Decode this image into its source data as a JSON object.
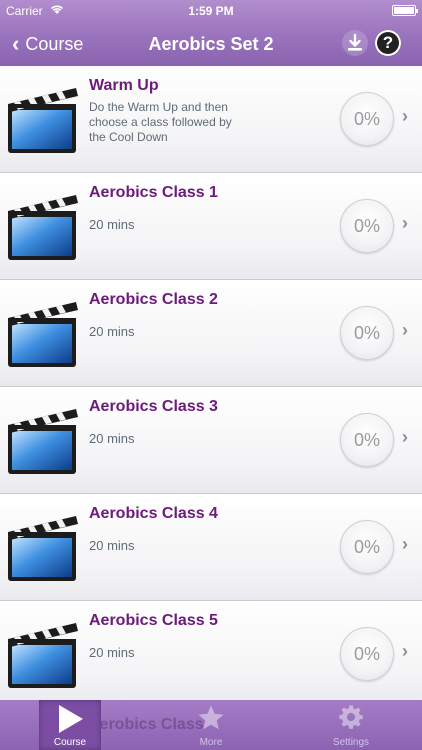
{
  "status_bar": {
    "carrier": "Carrier",
    "time": "1:59 PM"
  },
  "nav": {
    "back_label": "Course",
    "title": "Aerobics Set 2",
    "help_label": "?"
  },
  "lessons": [
    {
      "title": "Warm Up",
      "subtitle": "Do the Warm Up and then choose a class followed by the Cool Down",
      "progress": "0%"
    },
    {
      "title": "Aerobics Class 1",
      "subtitle": "20 mins",
      "progress": "0%"
    },
    {
      "title": "Aerobics Class 2",
      "subtitle": "20 mins",
      "progress": "0%"
    },
    {
      "title": "Aerobics Class 3",
      "subtitle": "20 mins",
      "progress": "0%"
    },
    {
      "title": "Aerobics Class 4",
      "subtitle": "20 mins",
      "progress": "0%"
    },
    {
      "title": "Aerobics Class 5",
      "subtitle": "20 mins",
      "progress": "0%"
    }
  ],
  "partial_row_title": "Aerobics Class",
  "tabs": [
    {
      "label": "Course",
      "icon": "play-icon",
      "active": true
    },
    {
      "label": "More",
      "icon": "star-icon",
      "active": false
    },
    {
      "label": "Settings",
      "icon": "gear-icon",
      "active": false
    }
  ],
  "colors": {
    "accent": "#9a73bd",
    "title_text": "#6c1b7a"
  }
}
